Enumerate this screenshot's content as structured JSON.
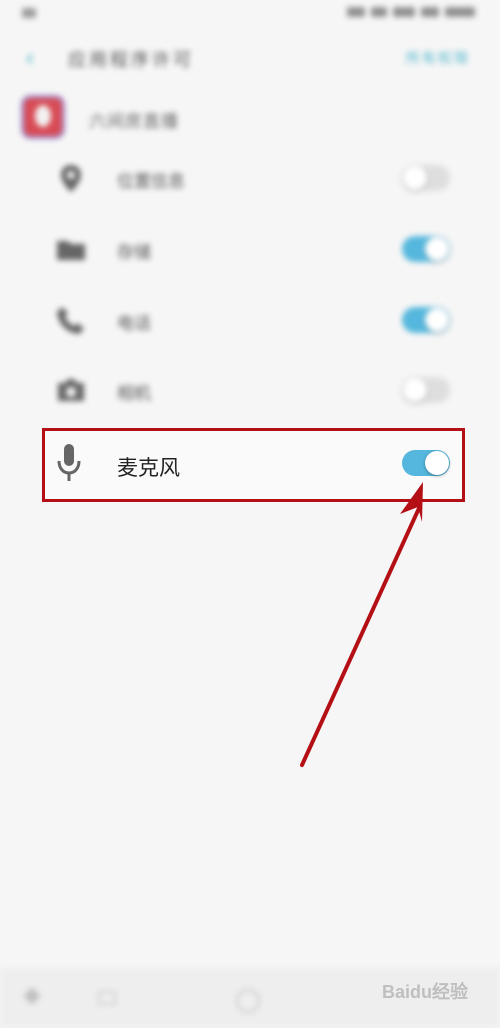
{
  "header": {
    "back_icon": "back-arrow-icon",
    "title": "应用程序许可",
    "action": "所有权限"
  },
  "app": {
    "name": "六间房直播"
  },
  "permissions": [
    {
      "label": "位置信息",
      "icon": "location-icon",
      "enabled": false
    },
    {
      "label": "存储",
      "icon": "folder-icon",
      "enabled": true
    },
    {
      "label": "电话",
      "icon": "phone-icon",
      "enabled": true
    },
    {
      "label": "相机",
      "icon": "camera-icon",
      "enabled": false
    },
    {
      "label": "麦克风",
      "icon": "microphone-icon",
      "enabled": true
    }
  ],
  "watermark": "Baidu经验",
  "colors": {
    "accent": "#55b7dd",
    "highlight": "#b50f16"
  }
}
